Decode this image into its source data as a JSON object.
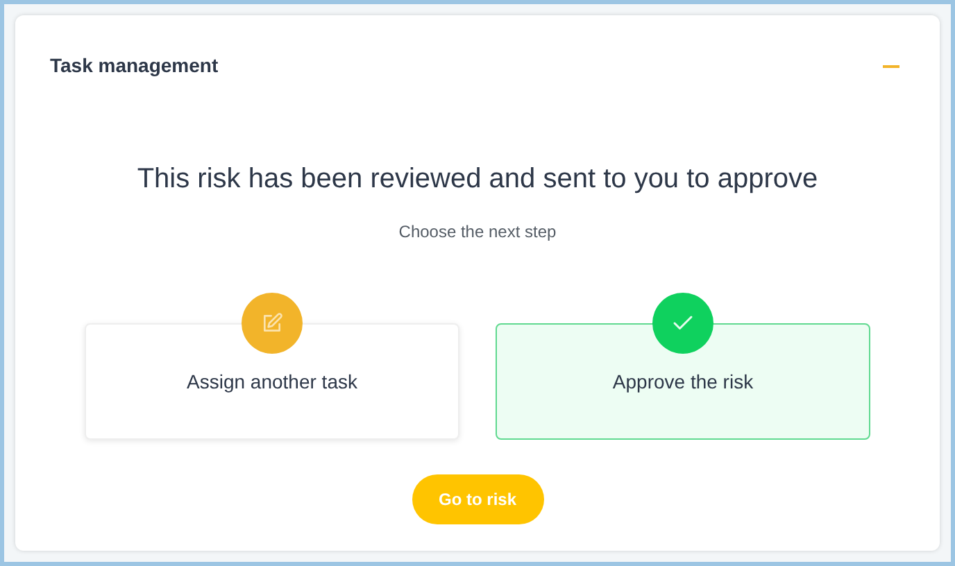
{
  "panel": {
    "title": "Task management",
    "expanded": true
  },
  "heading": "This risk has been reviewed and sent to you to approve",
  "subtitle": "Choose the next step",
  "options": [
    {
      "label": "Assign another task",
      "kind": "edit",
      "color": "#f2b42a",
      "selected": false
    },
    {
      "label": "Approve the risk",
      "kind": "check",
      "color": "#0fd15e",
      "selected": true
    }
  ],
  "button": "Go to risk"
}
